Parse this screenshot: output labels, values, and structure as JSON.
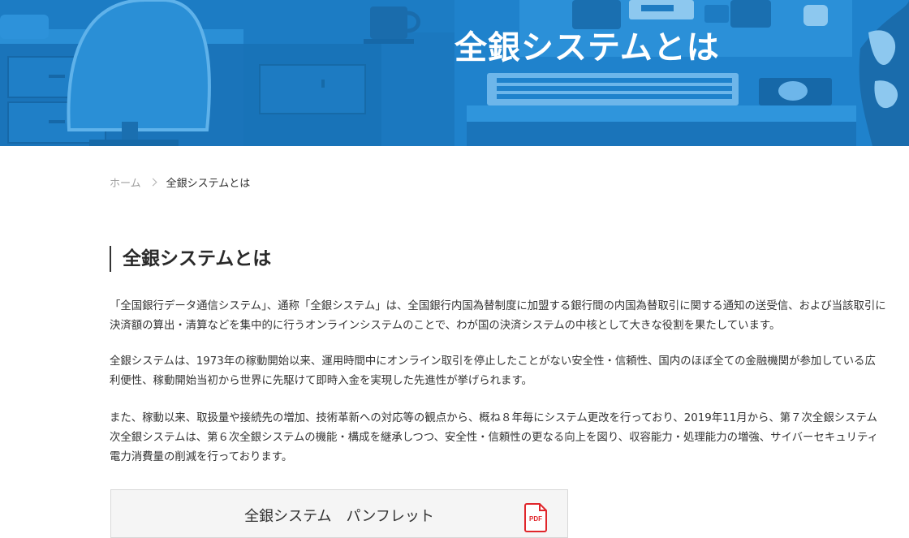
{
  "hero": {
    "title": "全銀システムとは"
  },
  "breadcrumb": {
    "home": "ホーム",
    "current": "全銀システムとは"
  },
  "section": {
    "heading": "全銀システムとは"
  },
  "paragraphs": [
    {
      "line1": "「全国銀行データ通信システム」、通称「全銀システム」は、全国銀行内国為替制度に加盟する銀行間の内国為替取引に関する通知の送受信、および当該取引に",
      "line2": "決済額の算出・清算などを集中的に行うオンラインシステムのことで、わが国の決済システムの中核として大きな役割を果たしています。"
    },
    {
      "line1": "全銀システムは、1973年の稼動開始以来、運用時間中にオンライン取引を停止したことがない安全性・信頼性、国内のほぼ全ての金融機関が参加している広",
      "line2": "利便性、稼動開始当初から世界に先駆けて即時入金を実現した先進性が挙げられます。"
    },
    {
      "line1": "また、稼動以来、取扱量や接続先の増加、技術革新への対応等の観点から、概ね８年毎にシステム更改を行っており、2019年11月から、第７次全銀システム",
      "line2": "次全銀システムは、第６次全銀システムの機能・構成を継承しつつ、安全性・信頼性の更なる向上を図り、収容能力・処理能力の増強、サイバーセキュリティ",
      "line3": "電力消費量の削減を行っております。"
    }
  ],
  "pamphlet": {
    "label": "全銀システム　パンフレット",
    "icon_text": "PDF",
    "icon": "pdf-file-icon"
  },
  "colors": {
    "hero_bg": "#1f82cc",
    "accent_red": "#e0262b",
    "text": "#333333"
  }
}
